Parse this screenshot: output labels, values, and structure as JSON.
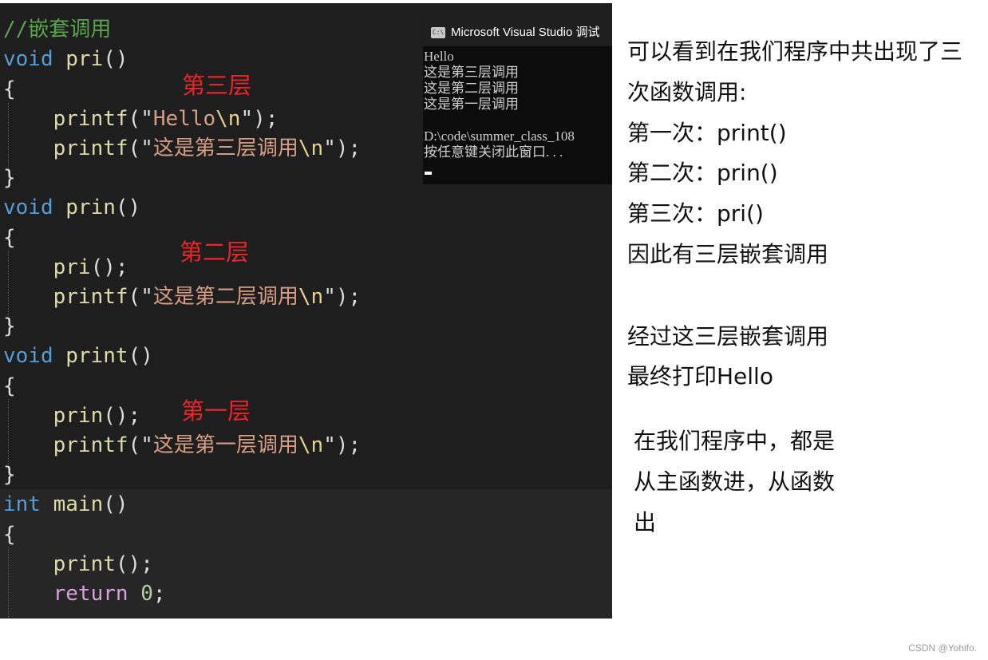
{
  "editor": {
    "comment": "//嵌套调用",
    "code": [
      {
        "kw": "void",
        "name": "pri",
        "rest": "()"
      },
      {
        "text": "{"
      },
      {
        "fn": "printf",
        "open": "(\"",
        "str": "Hello",
        "esc": "\\n",
        "close": "\");"
      },
      {
        "fn": "printf",
        "open": "(\"",
        "str": "这是第三层调用",
        "esc": "\\n",
        "close": "\");"
      },
      {
        "text": "}"
      },
      {
        "kw": "void",
        "name": "prin",
        "rest": "()"
      },
      {
        "text": "{"
      },
      {
        "fn": "pri",
        "close": "();"
      },
      {
        "fn": "printf",
        "open": "(\"",
        "str": "这是第二层调用",
        "esc": "\\n",
        "close": "\");"
      },
      {
        "text": "}"
      },
      {
        "kw": "void",
        "name": "print",
        "rest": "()"
      },
      {
        "text": "{"
      },
      {
        "fn": "prin",
        "close": "();"
      },
      {
        "fn": "printf",
        "open": "(\"",
        "str": "这是第一层调用",
        "esc": "\\n",
        "close": "\");"
      },
      {
        "text": "}"
      },
      {
        "kw": "int",
        "name": "main",
        "rest": "()"
      },
      {
        "text": "{"
      },
      {
        "fn": "print",
        "close": "();"
      },
      {
        "kw2": "return",
        "num": "0",
        "close": ";"
      }
    ],
    "labels": {
      "layer3": "第三层",
      "layer2": "第二层",
      "layer1": "第一层"
    }
  },
  "console": {
    "title": "Microsoft Visual Studio 调试",
    "icon": "console-app-icon",
    "output": [
      "Hello",
      "这是第三层调用",
      "这是第二层调用",
      "这是第一层调用",
      "",
      "D:\\code\\summer_class_108",
      "按任意键关闭此窗口. . ."
    ]
  },
  "notes": {
    "line1": "可以看到在我们程序中共出现了三",
    "line2": "次函数调用:",
    "line3": "第一次：print()",
    "line4": "第二次：prin()",
    "line5": "第三次：pri()",
    "line6": "因此有三层嵌套调用",
    "line7": "经过这三层嵌套调用",
    "line8": "最终打印Hello",
    "line9": "在我们程序中，都是",
    "line10": "从主函数进，从函数",
    "line11": "出"
  },
  "watermark": "CSDN @Yohifo."
}
